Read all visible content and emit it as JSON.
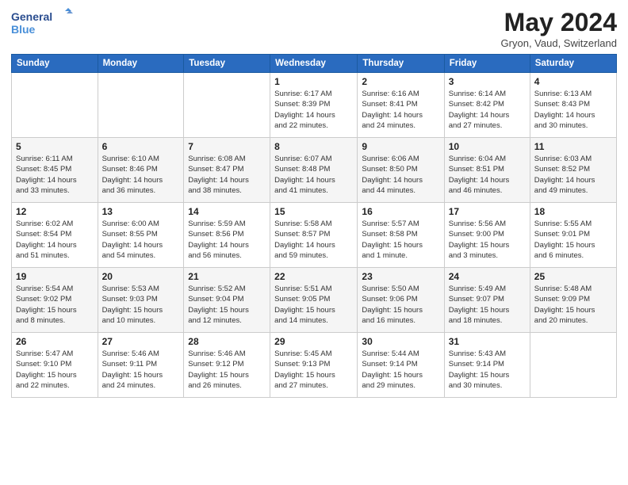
{
  "logo": {
    "line1": "General",
    "line2": "Blue"
  },
  "title": "May 2024",
  "subtitle": "Gryon, Vaud, Switzerland",
  "days_header": [
    "Sunday",
    "Monday",
    "Tuesday",
    "Wednesday",
    "Thursday",
    "Friday",
    "Saturday"
  ],
  "weeks": [
    [
      {
        "num": "",
        "info": ""
      },
      {
        "num": "",
        "info": ""
      },
      {
        "num": "",
        "info": ""
      },
      {
        "num": "1",
        "info": "Sunrise: 6:17 AM\nSunset: 8:39 PM\nDaylight: 14 hours\nand 22 minutes."
      },
      {
        "num": "2",
        "info": "Sunrise: 6:16 AM\nSunset: 8:41 PM\nDaylight: 14 hours\nand 24 minutes."
      },
      {
        "num": "3",
        "info": "Sunrise: 6:14 AM\nSunset: 8:42 PM\nDaylight: 14 hours\nand 27 minutes."
      },
      {
        "num": "4",
        "info": "Sunrise: 6:13 AM\nSunset: 8:43 PM\nDaylight: 14 hours\nand 30 minutes."
      }
    ],
    [
      {
        "num": "5",
        "info": "Sunrise: 6:11 AM\nSunset: 8:45 PM\nDaylight: 14 hours\nand 33 minutes."
      },
      {
        "num": "6",
        "info": "Sunrise: 6:10 AM\nSunset: 8:46 PM\nDaylight: 14 hours\nand 36 minutes."
      },
      {
        "num": "7",
        "info": "Sunrise: 6:08 AM\nSunset: 8:47 PM\nDaylight: 14 hours\nand 38 minutes."
      },
      {
        "num": "8",
        "info": "Sunrise: 6:07 AM\nSunset: 8:48 PM\nDaylight: 14 hours\nand 41 minutes."
      },
      {
        "num": "9",
        "info": "Sunrise: 6:06 AM\nSunset: 8:50 PM\nDaylight: 14 hours\nand 44 minutes."
      },
      {
        "num": "10",
        "info": "Sunrise: 6:04 AM\nSunset: 8:51 PM\nDaylight: 14 hours\nand 46 minutes."
      },
      {
        "num": "11",
        "info": "Sunrise: 6:03 AM\nSunset: 8:52 PM\nDaylight: 14 hours\nand 49 minutes."
      }
    ],
    [
      {
        "num": "12",
        "info": "Sunrise: 6:02 AM\nSunset: 8:54 PM\nDaylight: 14 hours\nand 51 minutes."
      },
      {
        "num": "13",
        "info": "Sunrise: 6:00 AM\nSunset: 8:55 PM\nDaylight: 14 hours\nand 54 minutes."
      },
      {
        "num": "14",
        "info": "Sunrise: 5:59 AM\nSunset: 8:56 PM\nDaylight: 14 hours\nand 56 minutes."
      },
      {
        "num": "15",
        "info": "Sunrise: 5:58 AM\nSunset: 8:57 PM\nDaylight: 14 hours\nand 59 minutes."
      },
      {
        "num": "16",
        "info": "Sunrise: 5:57 AM\nSunset: 8:58 PM\nDaylight: 15 hours\nand 1 minute."
      },
      {
        "num": "17",
        "info": "Sunrise: 5:56 AM\nSunset: 9:00 PM\nDaylight: 15 hours\nand 3 minutes."
      },
      {
        "num": "18",
        "info": "Sunrise: 5:55 AM\nSunset: 9:01 PM\nDaylight: 15 hours\nand 6 minutes."
      }
    ],
    [
      {
        "num": "19",
        "info": "Sunrise: 5:54 AM\nSunset: 9:02 PM\nDaylight: 15 hours\nand 8 minutes."
      },
      {
        "num": "20",
        "info": "Sunrise: 5:53 AM\nSunset: 9:03 PM\nDaylight: 15 hours\nand 10 minutes."
      },
      {
        "num": "21",
        "info": "Sunrise: 5:52 AM\nSunset: 9:04 PM\nDaylight: 15 hours\nand 12 minutes."
      },
      {
        "num": "22",
        "info": "Sunrise: 5:51 AM\nSunset: 9:05 PM\nDaylight: 15 hours\nand 14 minutes."
      },
      {
        "num": "23",
        "info": "Sunrise: 5:50 AM\nSunset: 9:06 PM\nDaylight: 15 hours\nand 16 minutes."
      },
      {
        "num": "24",
        "info": "Sunrise: 5:49 AM\nSunset: 9:07 PM\nDaylight: 15 hours\nand 18 minutes."
      },
      {
        "num": "25",
        "info": "Sunrise: 5:48 AM\nSunset: 9:09 PM\nDaylight: 15 hours\nand 20 minutes."
      }
    ],
    [
      {
        "num": "26",
        "info": "Sunrise: 5:47 AM\nSunset: 9:10 PM\nDaylight: 15 hours\nand 22 minutes."
      },
      {
        "num": "27",
        "info": "Sunrise: 5:46 AM\nSunset: 9:11 PM\nDaylight: 15 hours\nand 24 minutes."
      },
      {
        "num": "28",
        "info": "Sunrise: 5:46 AM\nSunset: 9:12 PM\nDaylight: 15 hours\nand 26 minutes."
      },
      {
        "num": "29",
        "info": "Sunrise: 5:45 AM\nSunset: 9:13 PM\nDaylight: 15 hours\nand 27 minutes."
      },
      {
        "num": "30",
        "info": "Sunrise: 5:44 AM\nSunset: 9:14 PM\nDaylight: 15 hours\nand 29 minutes."
      },
      {
        "num": "31",
        "info": "Sunrise: 5:43 AM\nSunset: 9:14 PM\nDaylight: 15 hours\nand 30 minutes."
      },
      {
        "num": "",
        "info": ""
      }
    ]
  ]
}
